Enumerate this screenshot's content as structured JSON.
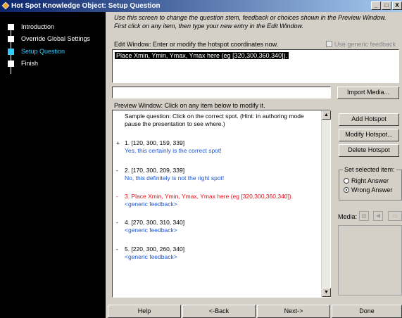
{
  "window": {
    "title": "Hot Spot Knowledge Object: Setup Question",
    "controls": [
      "_",
      "□",
      "X"
    ]
  },
  "sidebar": {
    "steps": [
      {
        "label": "Introduction",
        "active": false
      },
      {
        "label": "Override Global Settings",
        "active": false
      },
      {
        "label": "Setup Question",
        "active": true
      },
      {
        "label": "Finish",
        "active": false
      }
    ]
  },
  "instructions": "Use this screen to change the question stem, feedback or choices shown in the Preview Window. First click on any item, then type your new entry in the Edit Window.",
  "edit": {
    "label": "Edit Window: Enter or modify the hotspot coordinates now.",
    "generic_feedback_label": "Use generic feedback",
    "value": "Place Xmin, Ymin, Ymax, Ymax here (eg [320,300,360,340])."
  },
  "import_media_label": "Import Media...",
  "preview": {
    "label": "Preview Window: Click on any item below to modify it.",
    "question": "Sample question: Click on the correct spot. (Hint: in authoring mode pause the presentation to see where.)",
    "items": [
      {
        "mark": "+",
        "text": "1. [120, 300, 159, 339]",
        "feedback": "Yes, this certainly is the correct spot!"
      },
      {
        "mark": "-",
        "text": "2. [170, 300, 209, 339]",
        "feedback": "No, this definitely is not the right spot!"
      },
      {
        "mark": "-",
        "text": "3. Place Xmin, Ymin, Ymax, Ymax here (eg [320,300,360,340]).",
        "feedback": "<generic feedback>"
      },
      {
        "mark": "-",
        "text": "4. [270, 300, 310, 340]",
        "feedback": "<generic feedback>"
      },
      {
        "mark": "-",
        "text": "5. [220, 300, 260, 340]",
        "feedback": "<generic feedback>"
      }
    ]
  },
  "buttons": {
    "add_hotspot": "Add Hotspot",
    "modify_hotspot": "Modify Hotspot...",
    "delete_hotspot": "Delete Hotspot"
  },
  "set_selected": {
    "legend": "Set selected item:",
    "right": "Right Answer",
    "wrong": "Wrong Answer",
    "selected": "wrong"
  },
  "media_label": "Media:",
  "nav": {
    "help": "Help",
    "back": "<-Back",
    "next": "Next->",
    "done": "Done"
  },
  "colors": {
    "sidebar_bg": "#000000",
    "active_step": "#33ccff",
    "feedback_blue": "#1a55d8",
    "selected_red": "#e0101a",
    "title_gradient_start": "#0a246a"
  }
}
